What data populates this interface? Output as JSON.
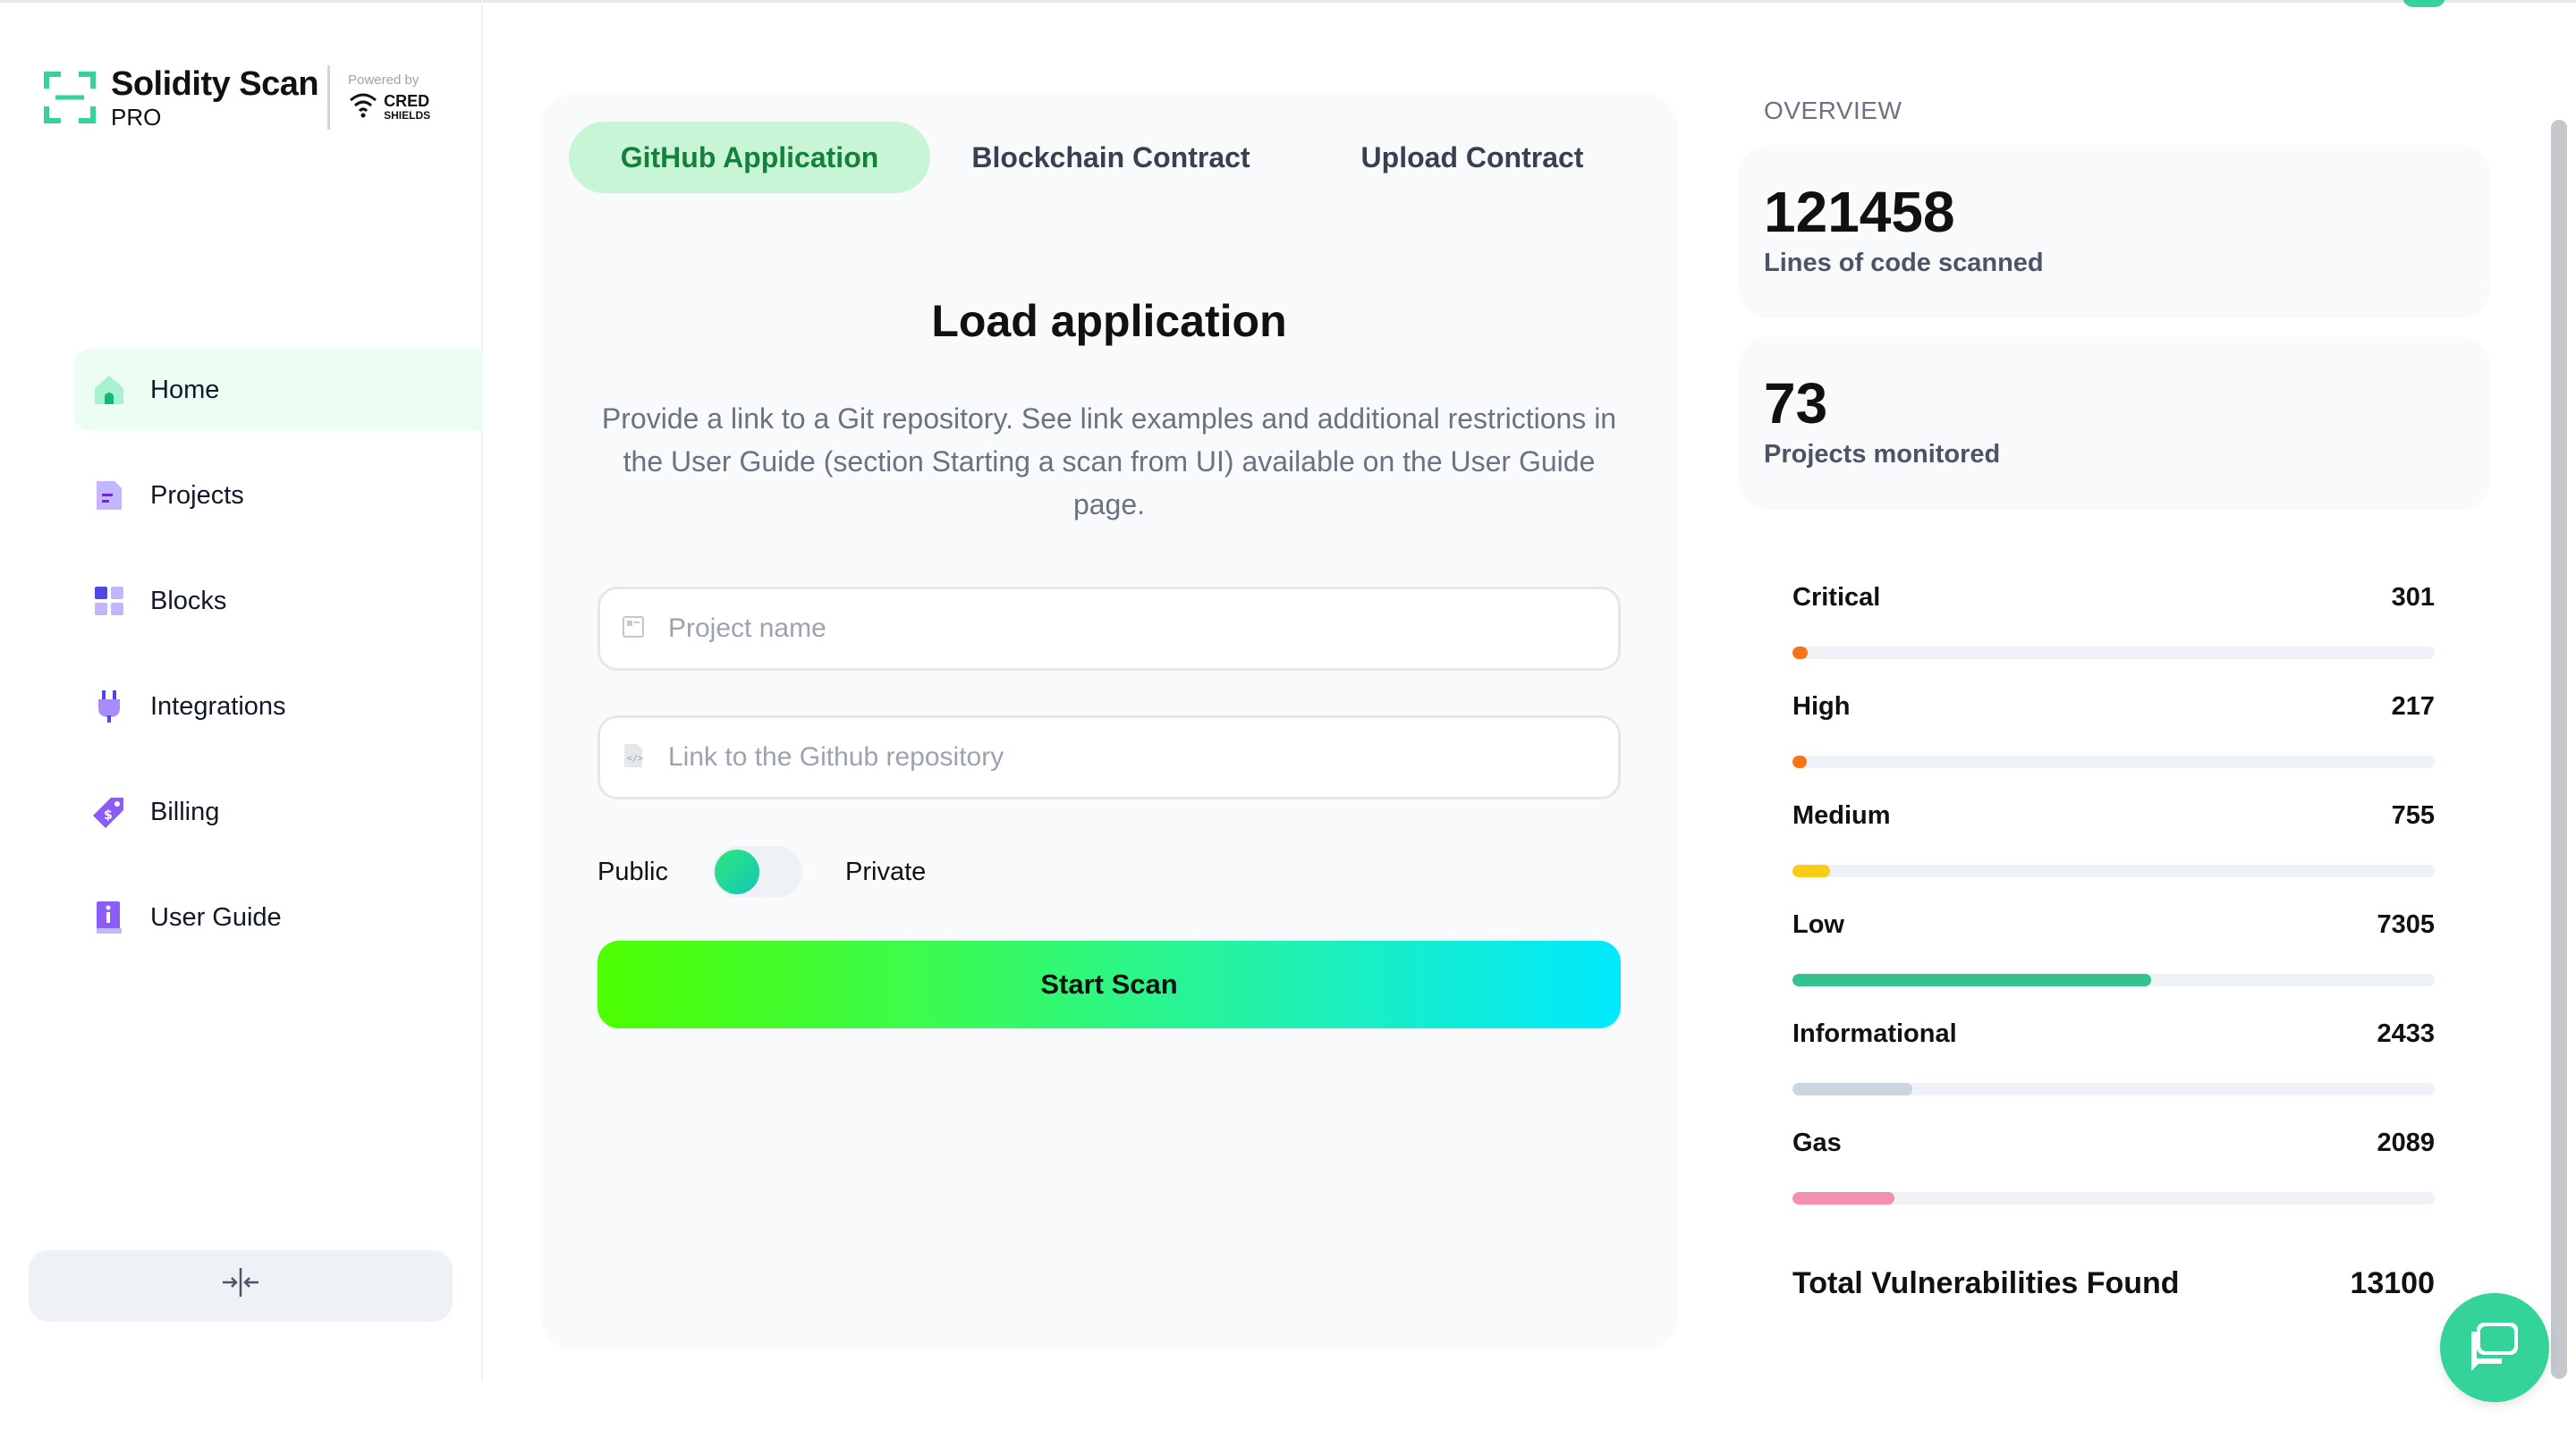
{
  "app": {
    "title": "Solidity Scan",
    "tier": "PRO",
    "powered_by": "Powered by",
    "partner": "CRED",
    "partner_sub": "SHIELDS"
  },
  "sidebar": {
    "items": [
      {
        "label": "Home",
        "icon": "home-icon",
        "active": true
      },
      {
        "label": "Projects",
        "icon": "document-icon",
        "active": false
      },
      {
        "label": "Blocks",
        "icon": "blocks-icon",
        "active": false
      },
      {
        "label": "Integrations",
        "icon": "plug-icon",
        "active": false
      },
      {
        "label": "Billing",
        "icon": "tag-icon",
        "active": false
      },
      {
        "label": "User Guide",
        "icon": "info-book-icon",
        "active": false
      }
    ],
    "collapse_icon": "collapse-icon"
  },
  "main": {
    "tabs": [
      {
        "label": "GitHub Application",
        "active": true
      },
      {
        "label": "Blockchain Contract",
        "active": false
      },
      {
        "label": "Upload Contract",
        "active": false
      }
    ],
    "title": "Load application",
    "description": "Provide a link to a Git repository. See link examples and additional restrictions in the User Guide (section Starting a scan from UI) available on the User Guide page.",
    "project_name": {
      "placeholder": "Project name",
      "value": ""
    },
    "repo_link": {
      "placeholder": "Link to the Github repository",
      "value": ""
    },
    "visibility": {
      "left_label": "Public",
      "right_label": "Private",
      "selected": "Public"
    },
    "start_button": "Start Scan"
  },
  "overview": {
    "label": "OVERVIEW",
    "stats": [
      {
        "value": "121458",
        "label": "Lines of code scanned"
      },
      {
        "value": "73",
        "label": "Projects monitored"
      }
    ],
    "severities": [
      {
        "name": "Critical",
        "count": "301",
        "fraction": 0.023,
        "color": "#f97316"
      },
      {
        "name": "High",
        "count": "217",
        "fraction": 0.017,
        "color": "#f97316"
      },
      {
        "name": "Medium",
        "count": "755",
        "fraction": 0.058,
        "color": "#facc15"
      },
      {
        "name": "Low",
        "count": "7305",
        "fraction": 0.558,
        "color": "#34c38f"
      },
      {
        "name": "Informational",
        "count": "2433",
        "fraction": 0.186,
        "color": "#cbd5e1"
      },
      {
        "name": "Gas",
        "count": "2089",
        "fraction": 0.159,
        "color": "#f48fb1"
      }
    ],
    "total_label": "Total Vulnerabilities Found",
    "total_value": "13100"
  },
  "colors": {
    "accent": "#34d399",
    "tab_active_bg": "#c8f5d6",
    "tab_active_text": "#15803d"
  }
}
